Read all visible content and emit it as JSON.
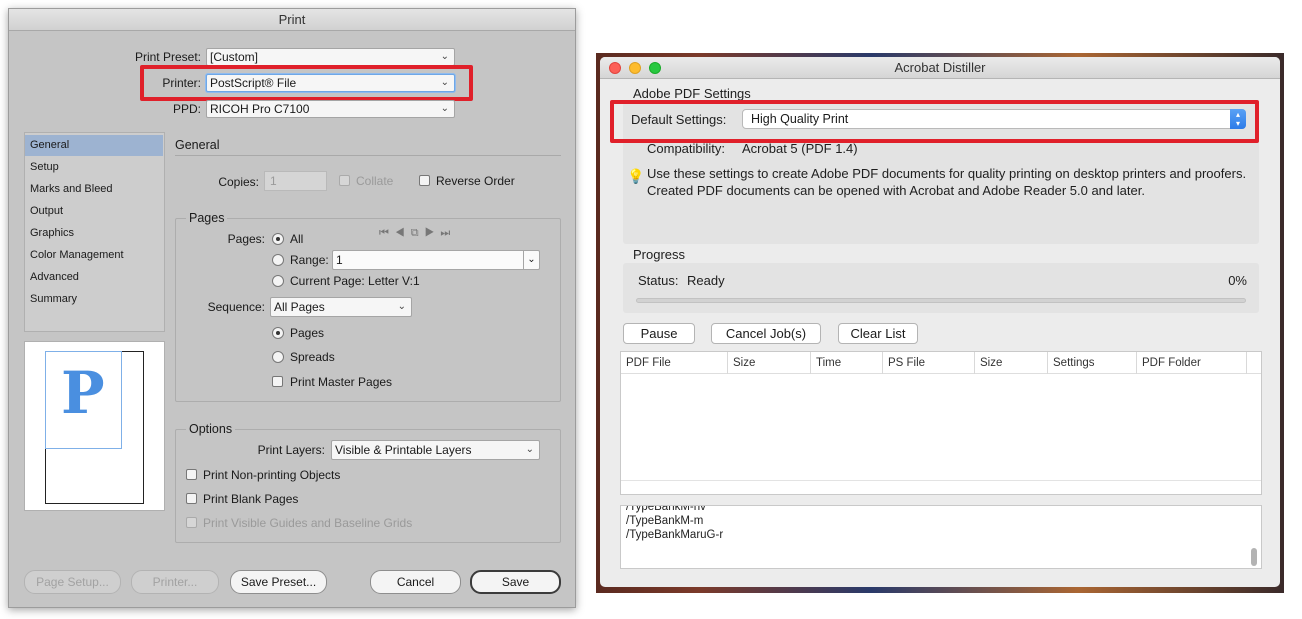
{
  "print_dialog": {
    "title": "Print",
    "print_preset": {
      "label": "Print Preset:",
      "value": "[Custom]"
    },
    "printer": {
      "label": "Printer:",
      "value": "PostScript® File"
    },
    "ppd": {
      "label": "PPD:",
      "value": "RICOH Pro C7100"
    },
    "sidebar": [
      "General",
      "Setup",
      "Marks and Bleed",
      "Output",
      "Graphics",
      "Color Management",
      "Advanced",
      "Summary"
    ],
    "preview_letter": "P",
    "general_heading": "General",
    "copies": {
      "label": "Copies:",
      "value": "1"
    },
    "collate_label": "Collate",
    "reverse_order_label": "Reverse Order",
    "pages_group": {
      "title": "Pages",
      "pages_label": "Pages:",
      "all_label": "All",
      "range_label": "Range:",
      "range_value": "1",
      "current_page_label": "Current Page: Letter V:1",
      "sequence_label": "Sequence:",
      "sequence_value": "All Pages",
      "pages_radio_label": "Pages",
      "spreads_label": "Spreads",
      "print_master_pages_label": "Print Master Pages"
    },
    "options_group": {
      "title": "Options",
      "print_layers_label": "Print Layers:",
      "print_layers_value": "Visible & Printable Layers",
      "non_printing_label": "Print Non-printing Objects",
      "blank_pages_label": "Print Blank Pages",
      "guides_label": "Print Visible Guides and Baseline Grids"
    },
    "buttons": {
      "page_setup": "Page Setup...",
      "printer": "Printer...",
      "save_preset": "Save Preset...",
      "cancel": "Cancel",
      "save": "Save"
    }
  },
  "distiller": {
    "title": "Acrobat Distiller",
    "pdf_settings_heading": "Adobe PDF Settings",
    "default_settings_label": "Default Settings:",
    "default_settings_value": "High Quality Print",
    "compatibility_label": "Compatibility:",
    "compatibility_value": "Acrobat 5 (PDF 1.4)",
    "description": "Use these settings to create Adobe PDF documents for quality printing on desktop printers and proofers.  Created PDF documents can be opened with Acrobat and Adobe Reader 5.0 and later.",
    "progress_heading": "Progress",
    "status_label": "Status:",
    "status_value": "Ready",
    "progress_percent": "0%",
    "progress_fraction": 0,
    "buttons": {
      "pause": "Pause",
      "cancel_jobs": "Cancel Job(s)",
      "clear_list": "Clear List"
    },
    "table_headers": [
      "PDF File",
      "Size",
      "Time",
      "PS File",
      "Size",
      "Settings",
      "PDF Folder"
    ],
    "log_lines": [
      "/TypeBankM-hv",
      "/TypeBankM-m",
      "/TypeBankMaruG-r"
    ]
  }
}
